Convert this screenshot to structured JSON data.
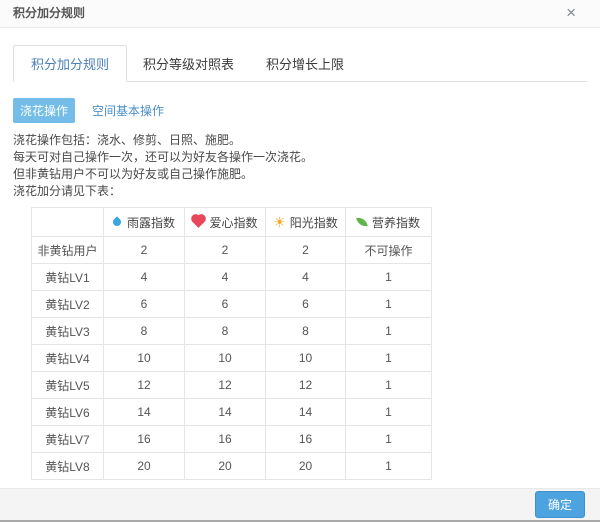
{
  "dialog": {
    "title": "积分加分规则",
    "close_glyph": "×"
  },
  "tabs": [
    {
      "label": "积分加分规则",
      "active": true
    },
    {
      "label": "积分等级对照表",
      "active": false
    },
    {
      "label": "积分增长上限",
      "active": false
    }
  ],
  "sub_tabs": [
    {
      "label": "浇花操作",
      "active": true
    },
    {
      "label": "空间基本操作",
      "active": false
    }
  ],
  "description_lines": [
    "浇花操作包括：浇水、修剪、日照、施肥。",
    "每天可对自己操作一次，还可以为好友各操作一次浇花。",
    "但非黄钻用户不可以为好友或自己操作施肥。",
    "浇花加分请见下表："
  ],
  "table": {
    "headers": [
      {
        "icon": "water-drop-icon",
        "label": "雨露指数"
      },
      {
        "icon": "heart-icon",
        "label": "爱心指数"
      },
      {
        "icon": "sun-icon",
        "label": "阳光指数",
        "glyph": "☀"
      },
      {
        "icon": "leaf-icon",
        "label": "营养指数"
      }
    ],
    "rows": [
      {
        "label": "非黄钻用户",
        "values": [
          "2",
          "2",
          "2",
          "不可操作"
        ]
      },
      {
        "label": "黄钻LV1",
        "values": [
          "4",
          "4",
          "4",
          "1"
        ]
      },
      {
        "label": "黄钻LV2",
        "values": [
          "6",
          "6",
          "6",
          "1"
        ]
      },
      {
        "label": "黄钻LV3",
        "values": [
          "8",
          "8",
          "8",
          "1"
        ]
      },
      {
        "label": "黄钻LV4",
        "values": [
          "10",
          "10",
          "10",
          "1"
        ]
      },
      {
        "label": "黄钻LV5",
        "values": [
          "12",
          "12",
          "12",
          "1"
        ]
      },
      {
        "label": "黄钻LV6",
        "values": [
          "14",
          "14",
          "14",
          "1"
        ]
      },
      {
        "label": "黄钻LV7",
        "values": [
          "16",
          "16",
          "16",
          "1"
        ]
      },
      {
        "label": "黄钻LV8",
        "values": [
          "20",
          "20",
          "20",
          "1"
        ]
      }
    ]
  },
  "footer": {
    "confirm_label": "确定"
  },
  "colors": {
    "accent_blue": "#4a90c8",
    "active_tab_text": "#4a7eb8",
    "subtab_active_bg": "#74bde8",
    "confirm_button_bg": "#4ca3e0",
    "water_drop": "#3aa5e0",
    "heart": "#e8475a",
    "sun": "#f6a623",
    "leaf": "#62b44e",
    "footer_bg": "#f4f4f4"
  }
}
